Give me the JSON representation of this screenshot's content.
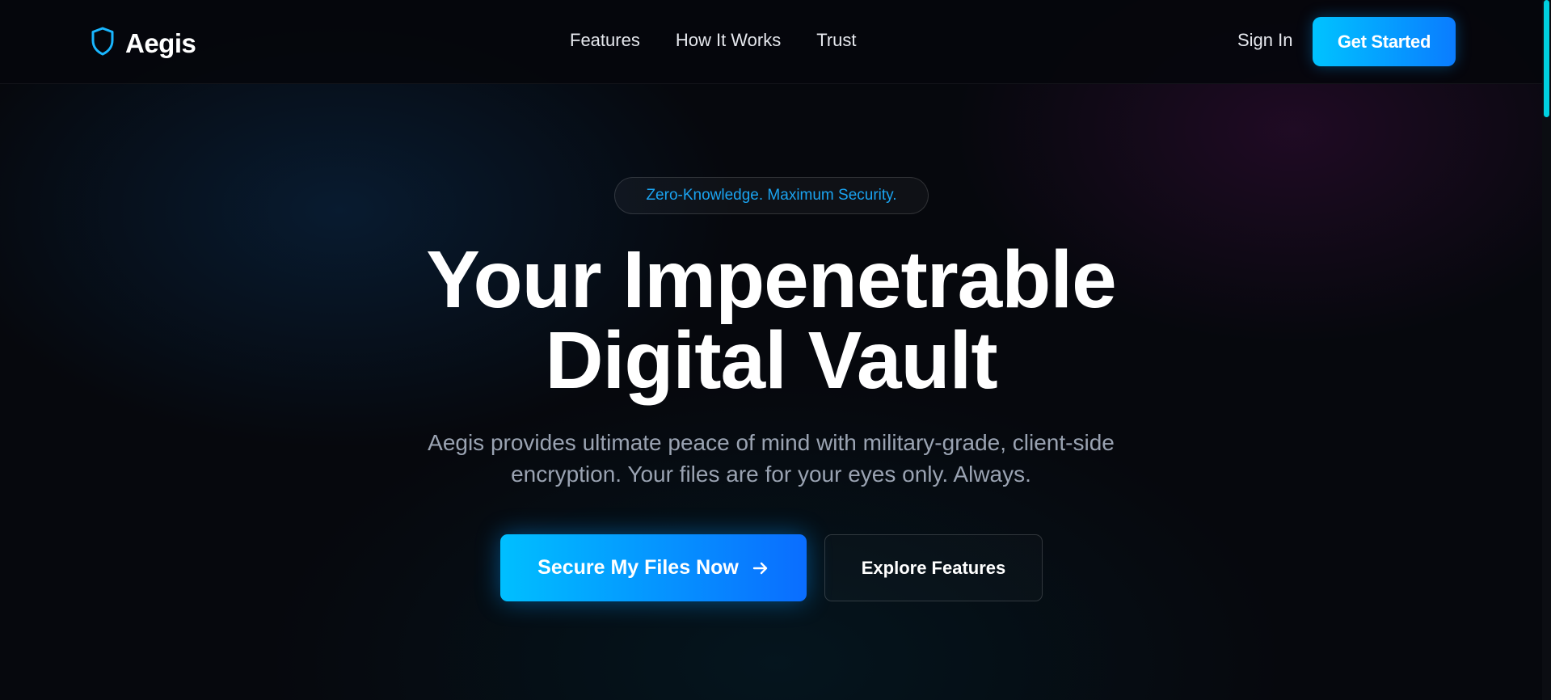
{
  "colors": {
    "accent": "#00c3ff",
    "accent_end": "#0a7cff",
    "background": "#06080d",
    "badge_text": "#1aa3f0",
    "subtitle_text": "#9aa3b2"
  },
  "nav": {
    "brand": {
      "name": "Aegis",
      "icon": "shield-icon"
    },
    "links": [
      "Features",
      "How It Works",
      "Trust"
    ],
    "sign_in": "Sign In",
    "get_started": "Get Started"
  },
  "hero": {
    "badge": "Zero-Knowledge. Maximum Security.",
    "headline_line1": "Your Impenetrable",
    "headline_line2": "Digital Vault",
    "subtitle_line1": "Aegis provides ultimate peace of mind with military-grade, client-side",
    "subtitle_line2": "encryption. Your files are for your eyes only. Always.",
    "cta_primary": {
      "label": "Secure My Files Now",
      "icon": "arrow-right-icon"
    },
    "cta_secondary": {
      "label": "Explore Features"
    }
  }
}
